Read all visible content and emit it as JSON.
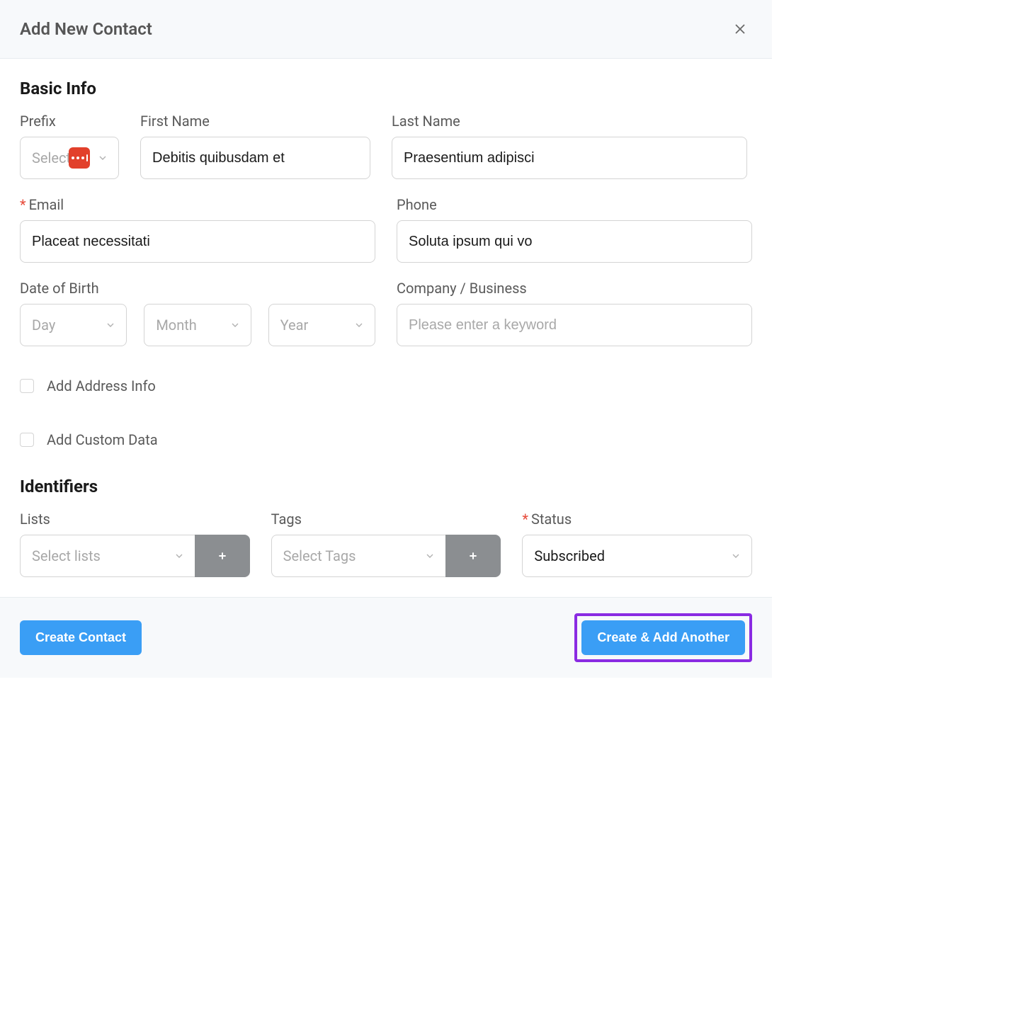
{
  "header": {
    "title": "Add New Contact"
  },
  "sections": {
    "basicInfo": {
      "title": "Basic Info",
      "prefix": {
        "label": "Prefix",
        "placeholder": "Select"
      },
      "firstName": {
        "label": "First Name",
        "value": "Debitis quibusdam et"
      },
      "lastName": {
        "label": "Last Name",
        "value": "Praesentium adipisci"
      },
      "email": {
        "label": "Email",
        "value": "Placeat necessitati",
        "required": true
      },
      "phone": {
        "label": "Phone",
        "value": "Soluta ipsum qui vo"
      },
      "dob": {
        "label": "Date of Birth",
        "day": "Day",
        "month": "Month",
        "year": "Year"
      },
      "company": {
        "label": "Company / Business",
        "placeholder": "Please enter a keyword"
      },
      "addAddress": {
        "label": "Add Address Info"
      },
      "addCustom": {
        "label": "Add Custom Data"
      }
    },
    "identifiers": {
      "title": "Identifiers",
      "lists": {
        "label": "Lists",
        "placeholder": "Select lists"
      },
      "tags": {
        "label": "Tags",
        "placeholder": "Select Tags"
      },
      "status": {
        "label": "Status",
        "value": "Subscribed",
        "required": true
      }
    }
  },
  "footer": {
    "create": "Create Contact",
    "createAnother": "Create & Add Another"
  }
}
